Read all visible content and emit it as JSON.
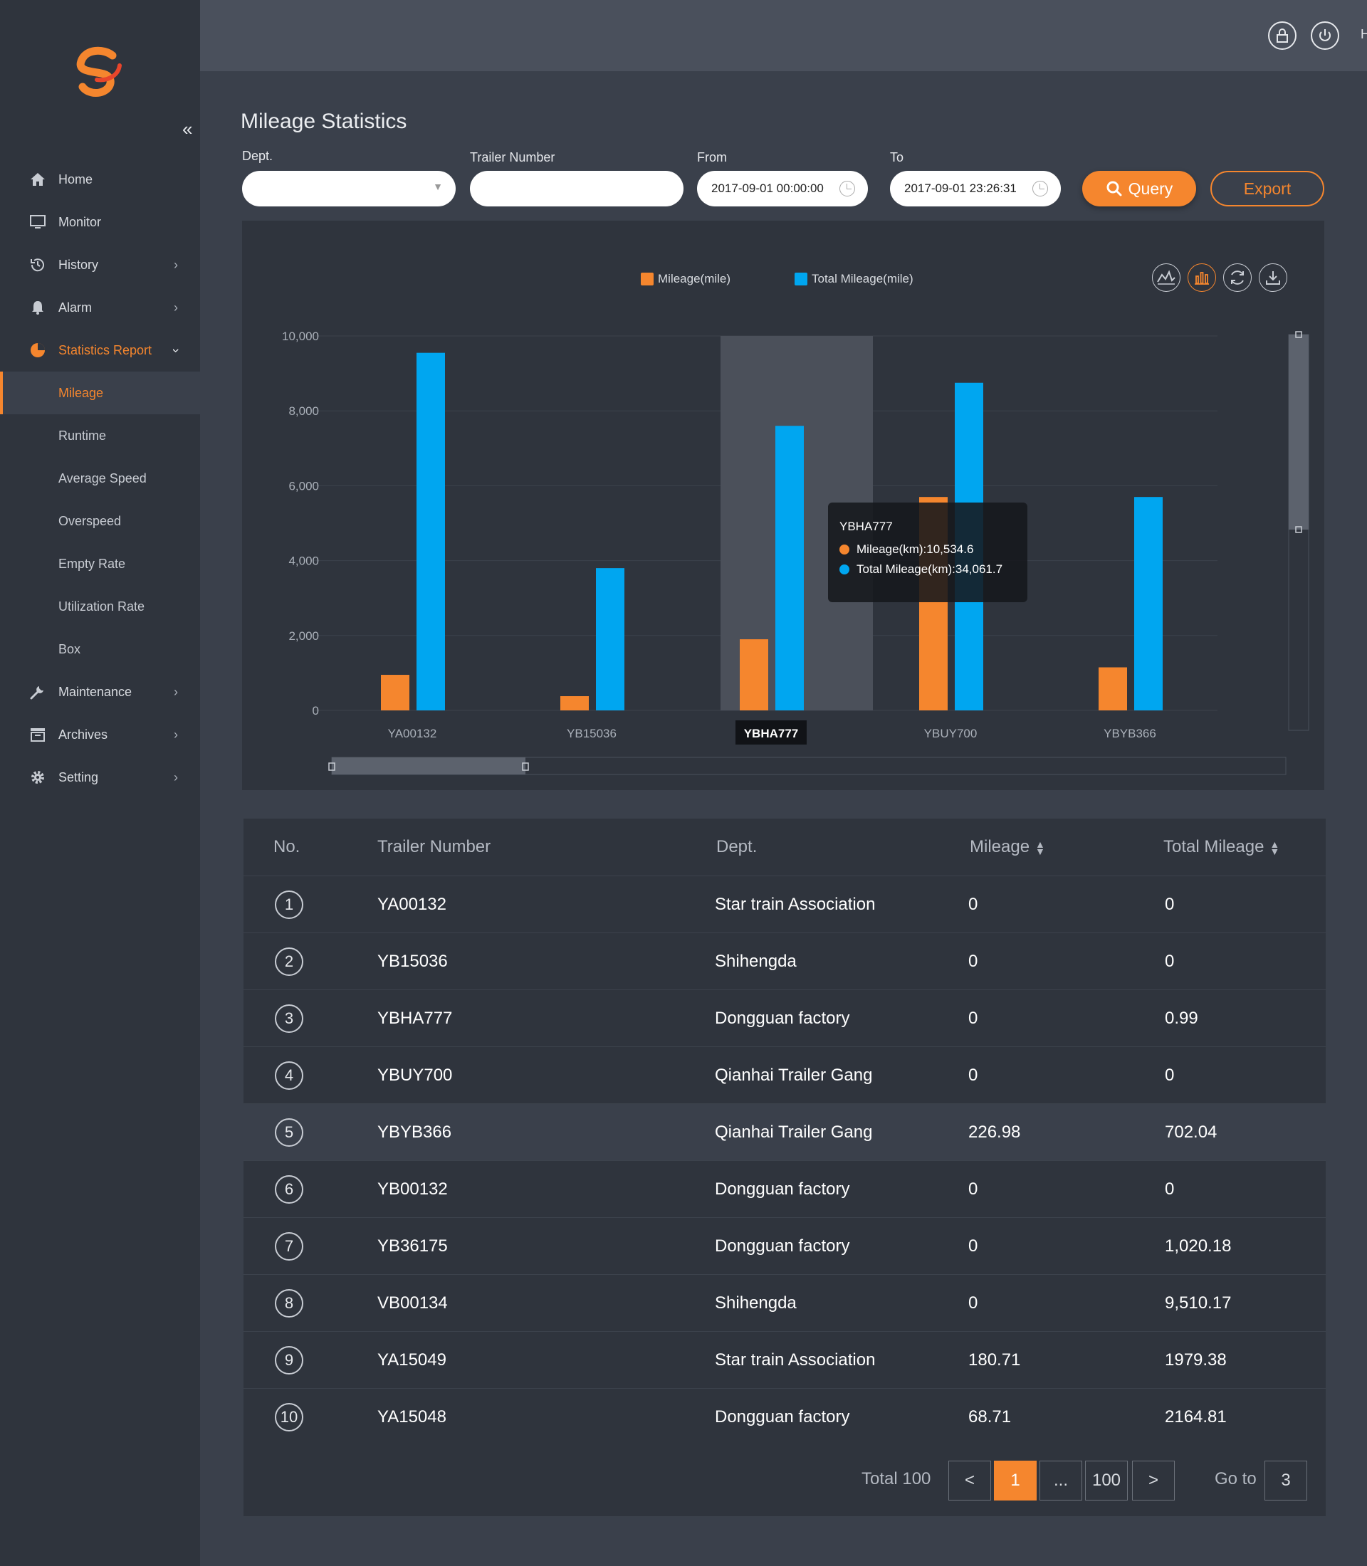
{
  "header": {
    "greeting": "Hello,Essie"
  },
  "sidebar": {
    "items": [
      {
        "label": "Home",
        "icon": "home-icon"
      },
      {
        "label": "Monitor",
        "icon": "monitor-icon"
      },
      {
        "label": "History",
        "icon": "history-icon"
      },
      {
        "label": "Alarm",
        "icon": "bell-icon"
      },
      {
        "label": "Statistics Report",
        "icon": "pie-chart-icon"
      },
      {
        "label": "Maintenance",
        "icon": "wrench-icon"
      },
      {
        "label": "Archives",
        "icon": "archive-icon"
      },
      {
        "label": "Setting",
        "icon": "gear-icon"
      }
    ],
    "sub_items": [
      "Mileage",
      "Runtime",
      "Average Speed",
      "Overspeed",
      "Empty Rate",
      "Utilization Rate",
      "Box"
    ],
    "selected": "Mileage"
  },
  "page": {
    "title": "Mileage Statistics"
  },
  "filters": {
    "dept_label": "Dept.",
    "dept_value": "",
    "trailer_label": "Trailer Number",
    "trailer_value": "",
    "from_label": "From",
    "from_value": "2017-09-01 00:00:00",
    "to_label": "To",
    "to_value": "2017-09-01 23:26:31",
    "query_label": "Query",
    "export_label": "Export"
  },
  "chart_data": {
    "type": "bar",
    "categories": [
      "YA00132",
      "YB15036",
      "YBHA777",
      "YBUY700",
      "YBYB366"
    ],
    "series": [
      {
        "name": "Mileage(mile)",
        "color": "#f5862e",
        "values": [
          950,
          380,
          1900,
          5700,
          1150
        ]
      },
      {
        "name": "Total Mileage(mile)",
        "color": "#00a6f0",
        "values": [
          9550,
          3800,
          7600,
          8750,
          5700
        ]
      }
    ],
    "ylim": [
      0,
      10000
    ],
    "yticks": [
      "10,000",
      "8,000",
      "6,000",
      "4,000",
      "2,000",
      "0"
    ],
    "highlighted_category": "YBHA777",
    "legend_position": "top-center",
    "tooltip": {
      "title": "YBHA777",
      "rows": [
        "Mileage(km):10,534.6",
        "Total Mileage(km):34,061.7"
      ]
    }
  },
  "chart_tools": [
    "line-chart-icon",
    "bar-chart-icon",
    "refresh-icon",
    "download-icon"
  ],
  "table": {
    "headers": {
      "no": "No.",
      "trailer": "Trailer Number",
      "dept": "Dept.",
      "mileage": "Mileage",
      "total": "Total Mileage"
    },
    "rows": [
      {
        "no": "1",
        "trailer": "YA00132",
        "dept": "Star train Association",
        "mileage": "0",
        "total": "0"
      },
      {
        "no": "2",
        "trailer": "YB15036",
        "dept": "Shihengda",
        "mileage": "0",
        "total": "0"
      },
      {
        "no": "3",
        "trailer": "YBHA777",
        "dept": "Dongguan factory",
        "mileage": "0",
        "total": "0.99"
      },
      {
        "no": "4",
        "trailer": "YBUY700",
        "dept": "Qianhai Trailer Gang",
        "mileage": "0",
        "total": "0"
      },
      {
        "no": "5",
        "trailer": "YBYB366",
        "dept": "Qianhai Trailer Gang",
        "mileage": "226.98",
        "total": "702.04"
      },
      {
        "no": "6",
        "trailer": "YB00132",
        "dept": "Dongguan factory",
        "mileage": "0",
        "total": "0"
      },
      {
        "no": "7",
        "trailer": "YB36175",
        "dept": "Dongguan factory",
        "mileage": "0",
        "total": "1,020.18"
      },
      {
        "no": "8",
        "trailer": "VB00134",
        "dept": "Shihengda",
        "mileage": "0",
        "total": "9,510.17"
      },
      {
        "no": "9",
        "trailer": "YA15049",
        "dept": "Star train Association",
        "mileage": "180.71",
        "total": "1979.38"
      },
      {
        "no": "10",
        "trailer": "YA15048",
        "dept": "Dongguan factory",
        "mileage": "68.71",
        "total": "2164.81"
      }
    ]
  },
  "pagination": {
    "total_text": "Total 100",
    "prev": "<",
    "current": "1",
    "ellipsis": "...",
    "last": "100",
    "next": ">",
    "goto_label": "Go to",
    "goto_value": "3"
  },
  "colors": {
    "accent": "#f5862e",
    "blue": "#00a6f0",
    "sidebar_bg": "#2f343d",
    "page_bg": "#3a404b"
  }
}
